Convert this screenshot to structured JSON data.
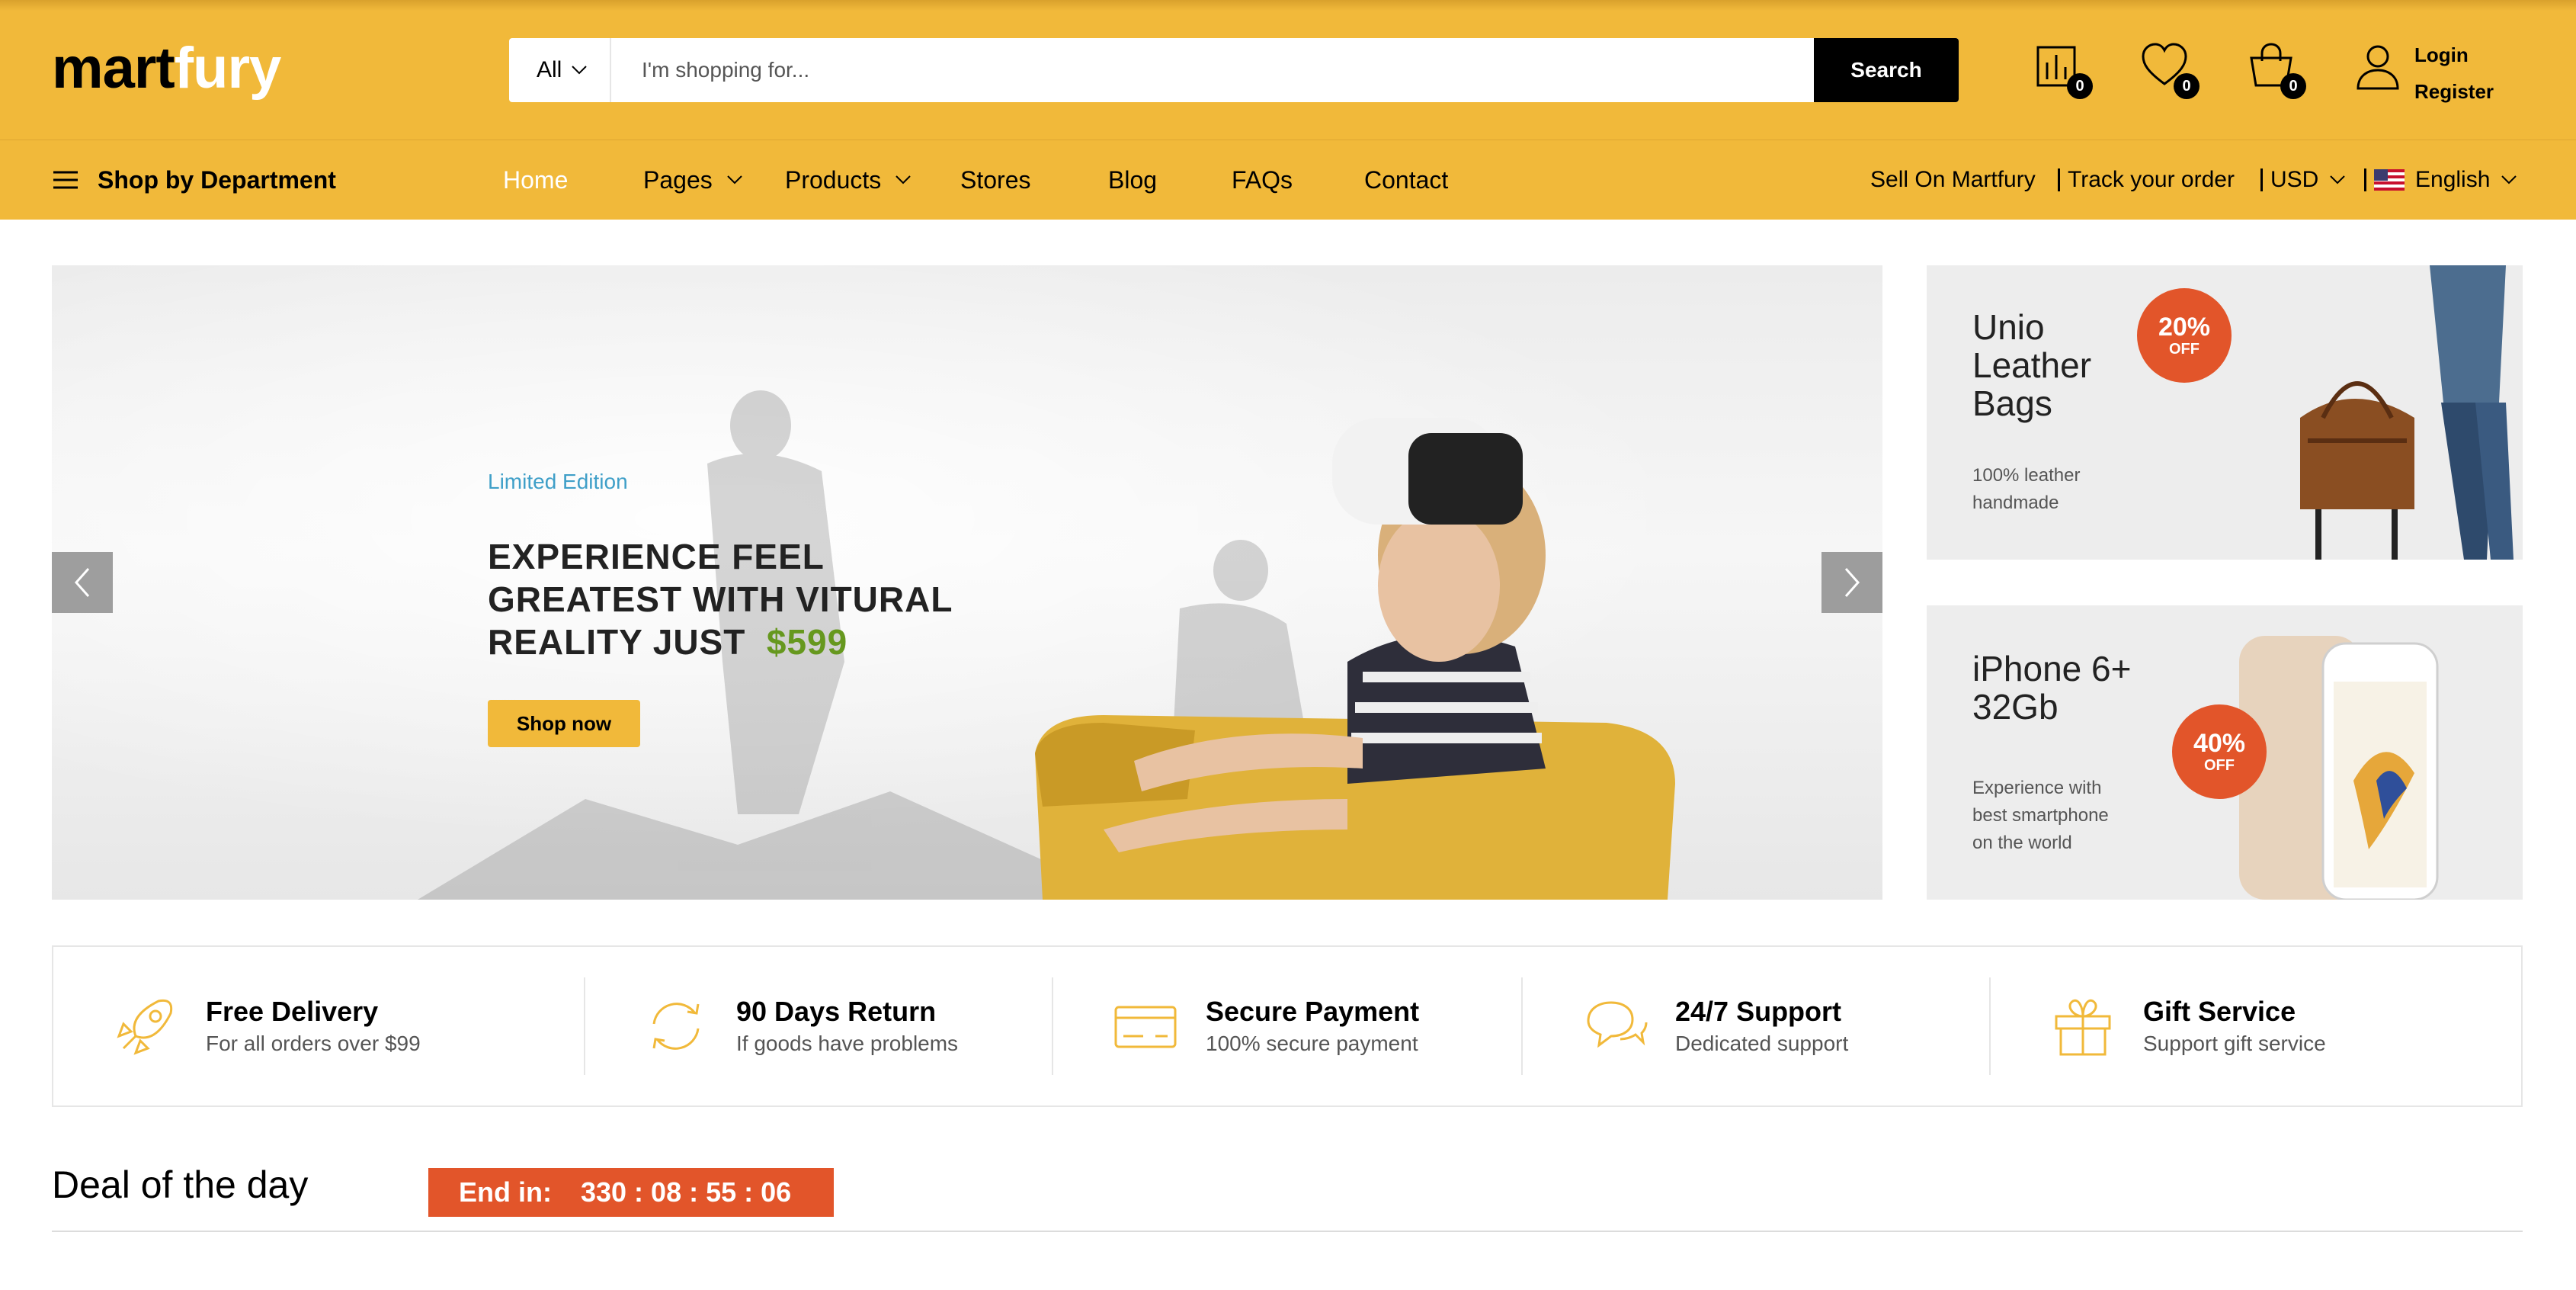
{
  "header": {
    "logo_part1": "mart",
    "logo_part2": "fury",
    "search": {
      "category": "All",
      "placeholder": "I'm shopping for...",
      "button": "Search"
    },
    "compare_count": "0",
    "wishlist_count": "0",
    "cart_count": "0",
    "login": "Login",
    "register": "Register"
  },
  "nav": {
    "department": "Shop by Department",
    "items": [
      {
        "label": "Home"
      },
      {
        "label": "Pages"
      },
      {
        "label": "Products"
      },
      {
        "label": "Stores"
      },
      {
        "label": "Blog"
      },
      {
        "label": "FAQs"
      },
      {
        "label": "Contact"
      }
    ],
    "sell": "Sell On Martfury",
    "track": "Track your order",
    "currency": "USD",
    "language": "English"
  },
  "hero": {
    "tag": "Limited Edition",
    "title_line1": "EXPERIENCE FEEL",
    "title_line2": "GREATEST WITH VITURAL",
    "title_line3": "REALITY JUST",
    "price": "$599",
    "button": "Shop now"
  },
  "promos": [
    {
      "title_l1": "Unio",
      "title_l2": "Leather",
      "title_l3": "Bags",
      "sub_l1": "100% leather",
      "sub_l2": "handmade",
      "sub_l3": "",
      "discount": "20%",
      "off": "OFF"
    },
    {
      "title_l1": "iPhone 6+",
      "title_l2": "32Gb",
      "title_l3": "",
      "sub_l1": "Experience with",
      "sub_l2": "best smartphone",
      "sub_l3": "on the world",
      "discount": "40%",
      "off": "OFF"
    }
  ],
  "features": [
    {
      "title": "Free Delivery",
      "sub": "For all orders over $99",
      "icon": "rocket-icon"
    },
    {
      "title": "90 Days Return",
      "sub": "If goods have problems",
      "icon": "sync-icon"
    },
    {
      "title": "Secure Payment",
      "sub": "100% secure payment",
      "icon": "credit-card-icon"
    },
    {
      "title": "24/7 Support",
      "sub": "Dedicated support",
      "icon": "chat-icon"
    },
    {
      "title": "Gift Service",
      "sub": "Support gift service",
      "icon": "gift-icon"
    }
  ],
  "deal": {
    "title": "Deal of the day",
    "end_label": "End in:",
    "timer": "330 : 08 : 55 : 06"
  },
  "colors": {
    "brand_yellow": "#f1b93a",
    "countdown_orange": "#e2552a",
    "price_green": "#66981e",
    "tag_blue": "#3f9fc8"
  }
}
